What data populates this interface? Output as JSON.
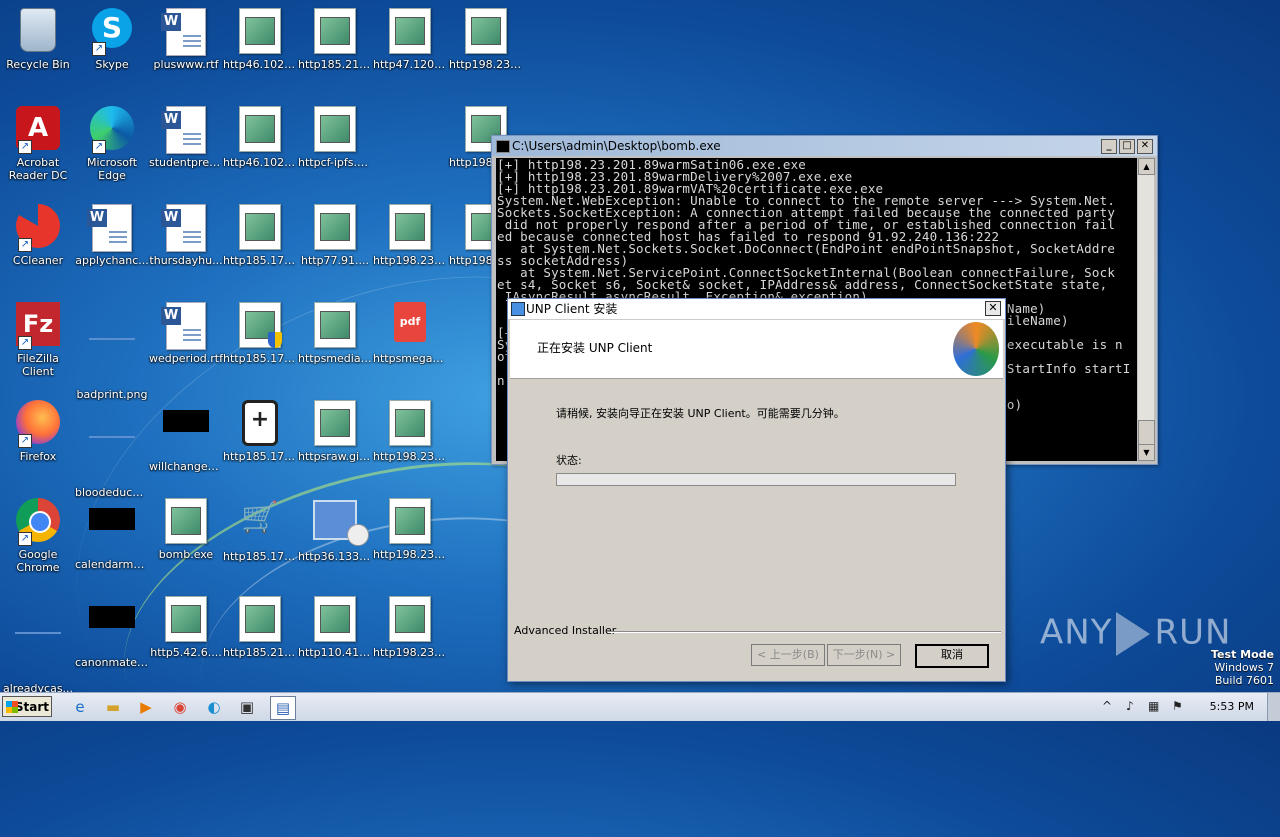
{
  "desktop": {
    "icons": [
      {
        "name": "recycle-bin-icon",
        "label": "Recycle Bin",
        "type": "bin"
      },
      {
        "name": "skype-icon",
        "label": "Skype",
        "type": "skype",
        "shortcut": true
      },
      {
        "name": "rtf-file-icon",
        "label": "pluswww.rtf",
        "type": "rtf"
      },
      {
        "name": "file-icon",
        "label": "http46.102....",
        "type": "file"
      },
      {
        "name": "file-icon",
        "label": "http185.21....",
        "type": "file"
      },
      {
        "name": "file-icon",
        "label": "http47.120....",
        "type": "file"
      },
      {
        "name": "file-icon",
        "label": "http198.23....",
        "type": "file"
      },
      {
        "name": "acrobat-icon",
        "label": "Acrobat Reader DC",
        "type": "acrobat",
        "shortcut": true
      },
      {
        "name": "edge-icon",
        "label": "Microsoft Edge",
        "type": "edge",
        "shortcut": true
      },
      {
        "name": "rtf-file-icon",
        "label": "studentpres...",
        "type": "rtf"
      },
      {
        "name": "file-icon",
        "label": "http46.102....",
        "type": "file"
      },
      {
        "name": "file-icon",
        "label": "httpcf-ipfs.c...",
        "type": "file"
      },
      {
        "name": "file-icon",
        "label": "http198.23....",
        "type": "file"
      },
      {
        "name": "ccleaner-icon",
        "label": "CCleaner",
        "type": "ccleaner",
        "shortcut": true
      },
      {
        "name": "rtf-file-icon",
        "label": "applychanc...",
        "type": "rtf"
      },
      {
        "name": "rtf-file-icon",
        "label": "thursdayhu...",
        "type": "rtf"
      },
      {
        "name": "file-icon",
        "label": "http185.17....",
        "type": "file"
      },
      {
        "name": "file-icon",
        "label": "http77.91....",
        "type": "file"
      },
      {
        "name": "file-icon",
        "label": "http198.23....",
        "type": "file"
      },
      {
        "name": "file-icon",
        "label": "http198.23....",
        "type": "file"
      },
      {
        "name": "filezilla-icon",
        "label": "FileZilla Client",
        "type": "fz",
        "shortcut": true
      },
      {
        "name": "image-file-icon",
        "label": "badprint.png",
        "type": "blank"
      },
      {
        "name": "rtf-file-icon",
        "label": "wedperiod.rtf",
        "type": "rtf"
      },
      {
        "name": "file-shield-icon",
        "label": "http185.17....",
        "type": "file",
        "shield": true
      },
      {
        "name": "file-icon",
        "label": "httpsmediafi...",
        "type": "file"
      },
      {
        "name": "pdf-icon",
        "label": "httpsmegab...",
        "type": "pdf"
      },
      {
        "name": "firefox-icon",
        "label": "Firefox",
        "type": "firefox",
        "shortcut": true
      },
      {
        "name": "image-file-icon",
        "label": "bloodeduca...",
        "type": "blank"
      },
      {
        "name": "image-file-icon",
        "label": "willchanges...",
        "type": "black"
      },
      {
        "name": "first-aid-kit-icon",
        "label": "http185.17....",
        "type": "kit"
      },
      {
        "name": "file-icon",
        "label": "httpsraw.git...",
        "type": "file"
      },
      {
        "name": "file-icon",
        "label": "http198.23....",
        "type": "file"
      },
      {
        "name": "chrome-icon",
        "label": "Google Chrome",
        "type": "chrome",
        "shortcut": true
      },
      {
        "name": "image-file-icon",
        "label": "calendarmet...",
        "type": "black"
      },
      {
        "name": "file-icon",
        "label": "bomb.exe",
        "type": "file"
      },
      {
        "name": "shopping-cart-icon",
        "label": "http185.17....",
        "type": "cart"
      },
      {
        "name": "computer-disc-icon",
        "label": "http36.133....",
        "type": "pc"
      },
      {
        "name": "file-icon",
        "label": "http198.23....",
        "type": "file"
      },
      {
        "name": "image-file-icon",
        "label": "alreadycas...",
        "type": "blank"
      },
      {
        "name": "image-file-icon",
        "label": "canonmater...",
        "type": "black"
      },
      {
        "name": "file-icon",
        "label": "http5.42.6....",
        "type": "file"
      },
      {
        "name": "file-icon",
        "label": "http185.21....",
        "type": "file"
      },
      {
        "name": "file-icon",
        "label": "http110.41....",
        "type": "file"
      },
      {
        "name": "file-icon",
        "label": "http198.23....",
        "type": "file"
      }
    ]
  },
  "console": {
    "title": "C:\\Users\\admin\\Desktop\\bomb.exe",
    "text": "[+] http198.23.201.89warmSatin06.exe.exe\n[+] http198.23.201.89warmDelivery%2007.exe.exe\n[+] http198.23.201.89warmVAT%20certificate.exe.exe\nSystem.Net.WebException: Unable to connect to the remote server ---> System.Net.\nSockets.SocketException: A connection attempt failed because the connected party\n did not properly respond after a period of time, or established connection fail\ned because connected host has failed to respond 91.92.240.136:222\n   at System.Net.Sockets.Socket.DoConnect(EndPoint endPointSnapshot, SocketAddre\nss socketAddress)\n   at System.Net.ServicePoint.ConnectSocketInternal(Boolean connectFailure, Sock\net s4, Socket s6, Socket& socket, IPAddress& address, ConnectSocketState state,\n IAsyncResult asyncResult, Exception& exception)\n                                                                  Name)\n                                                                  ileName)\n[+\nSy                                                                executable is n\not\n                                                                  StartInfo startI\nn\n\n                                                                  o)"
  },
  "installer": {
    "title": "UNP Client 安装",
    "heading": "正在安装 UNP Client",
    "message": "请稍候, 安装向导正在安装 UNP Client。可能需要几分钟。",
    "status_label": "状态:",
    "progress": 0.0,
    "brand": "Advanced Installer",
    "back": "< 上一步(B)",
    "next": "下一步(N) >",
    "cancel": "取消"
  },
  "watermark": {
    "text_left": "ANY",
    "text_right": "RUN"
  },
  "testmode": {
    "line1": "Test Mode",
    "line2": "Windows 7",
    "line3": "Build 7601"
  },
  "taskbar": {
    "start": "Start",
    "clock": "5:53 PM"
  }
}
